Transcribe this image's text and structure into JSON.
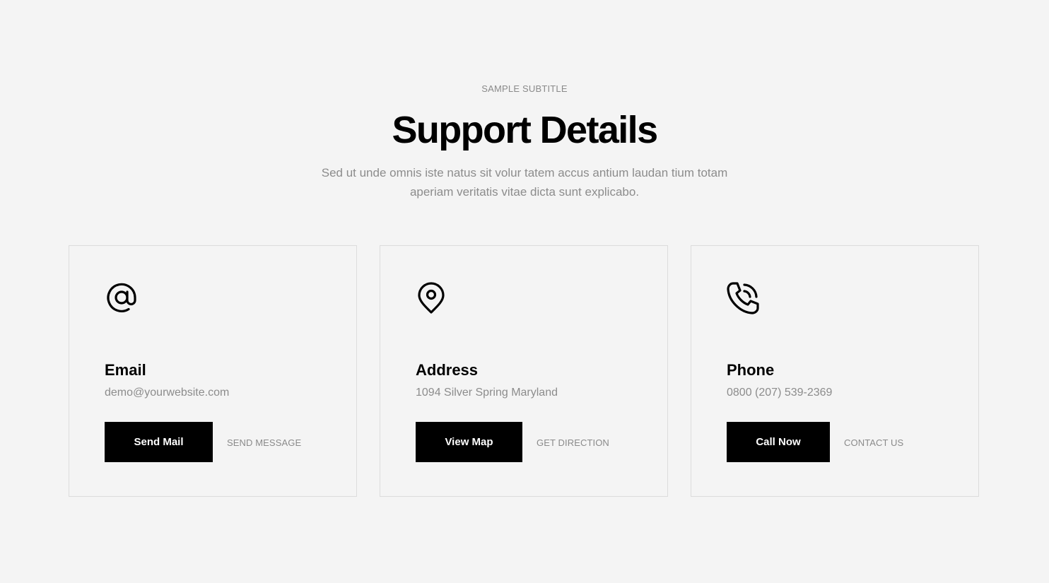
{
  "section": {
    "subtitle": "SAMPLE SUBTITLE",
    "title": "Support Details",
    "description": "Sed ut unde omnis iste natus sit volur tatem accus antium laudan tium totam aperiam veritatis vitae dicta sunt explicabo."
  },
  "cards": [
    {
      "icon": "at-sign-icon",
      "title": "Email",
      "value": "demo@yourwebsite.com",
      "button_label": "Send Mail",
      "link_label": "SEND MESSAGE"
    },
    {
      "icon": "map-pin-icon",
      "title": "Address",
      "value": "1094 Silver Spring Maryland",
      "button_label": "View Map",
      "link_label": "GET DIRECTION"
    },
    {
      "icon": "phone-call-icon",
      "title": "Phone",
      "value": "0800 (207) 539-2369",
      "button_label": "Call Now",
      "link_label": "CONTACT US"
    }
  ],
  "colors": {
    "background": "#f4f4f4",
    "accent": "#000000",
    "muted_text": "#8c8c8c",
    "card_border": "#dcdcdc"
  }
}
